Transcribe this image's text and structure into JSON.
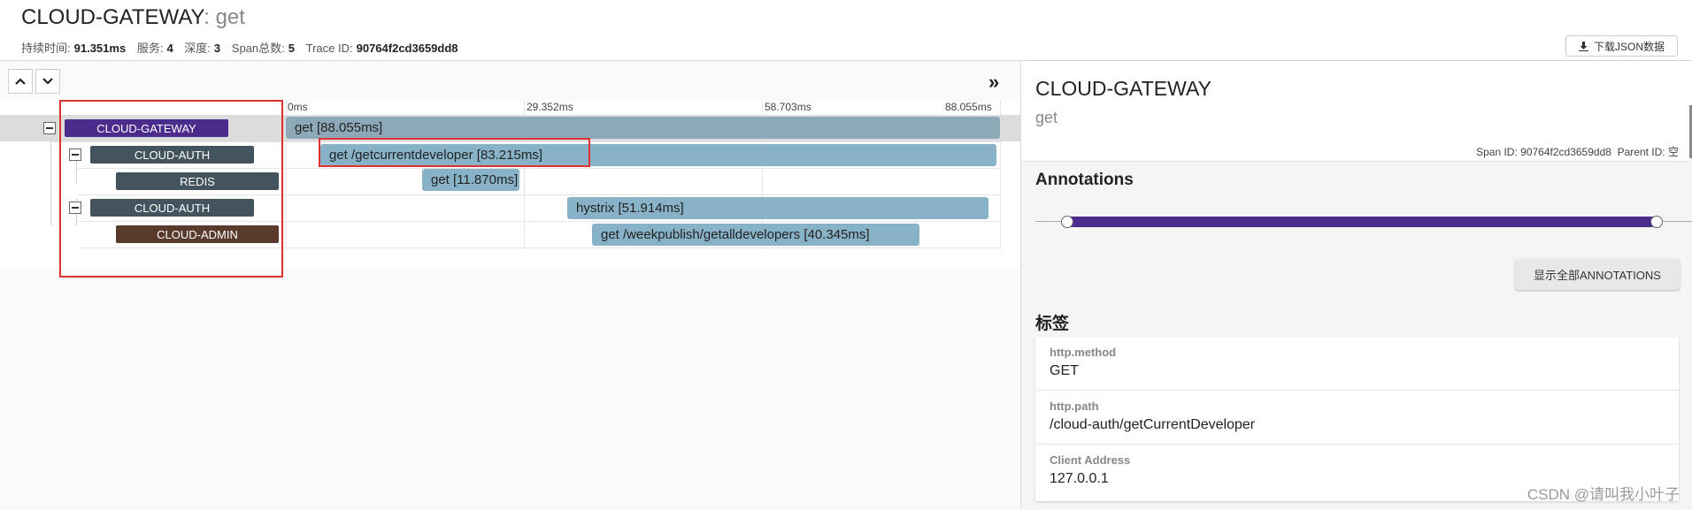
{
  "header": {
    "service": "CLOUD-GATEWAY",
    "operation": ": get",
    "summary": [
      {
        "label": "持续时间:",
        "value": "91.351ms"
      },
      {
        "label": "服务:",
        "value": "4"
      },
      {
        "label": "深度:",
        "value": "3"
      },
      {
        "label": "Span总数:",
        "value": "5"
      },
      {
        "label": "Trace ID:",
        "value": "90764f2cd3659dd8"
      }
    ],
    "download_label": "下载JSON数据"
  },
  "timeline": {
    "ticks": [
      "0ms",
      "29.352ms",
      "58.703ms",
      "88.055ms"
    ],
    "rows": [
      {
        "service": "CLOUD-GATEWAY",
        "span_label": "get [88.055ms]",
        "service_color": "#4b2b8c",
        "bar_color": "#8da9b8",
        "selected": true
      },
      {
        "service": "CLOUD-AUTH",
        "span_label": "get /getcurrentdeveloper [83.215ms]",
        "service_color": "#44545f",
        "bar_color": "#88b2c7"
      },
      {
        "service": "REDIS",
        "span_label": "get [11.870ms]",
        "service_color": "#44545f",
        "bar_color": "#88b2c7"
      },
      {
        "service": "CLOUD-AUTH",
        "span_label": "hystrix [51.914ms]",
        "service_color": "#44545f",
        "bar_color": "#88b2c7"
      },
      {
        "service": "CLOUD-ADMIN",
        "span_label": "get /weekpublish/getalldevelopers [40.345ms]",
        "service_color": "#5b3a2e",
        "bar_color": "#88b2c7"
      }
    ]
  },
  "detail": {
    "service": "CLOUD-GATEWAY",
    "operation": "get",
    "span_id_label": "Span ID:",
    "span_id": "90764f2cd3659dd8",
    "parent_id_label": "Parent ID:",
    "parent_id": "空",
    "annotations_heading": "Annotations",
    "show_all_label": "显示全部ANNOTATIONS",
    "tags_heading": "标签",
    "tags": [
      {
        "key": "http.method",
        "value": "GET"
      },
      {
        "key": "http.path",
        "value": "/cloud-auth/getCurrentDeveloper"
      },
      {
        "key": "Client Address",
        "value": "127.0.0.1"
      }
    ]
  },
  "watermark": "CSDN @请叫我小叶子",
  "colors": {
    "accent": "#4b2b8c",
    "highlight_red": "#e03131"
  }
}
